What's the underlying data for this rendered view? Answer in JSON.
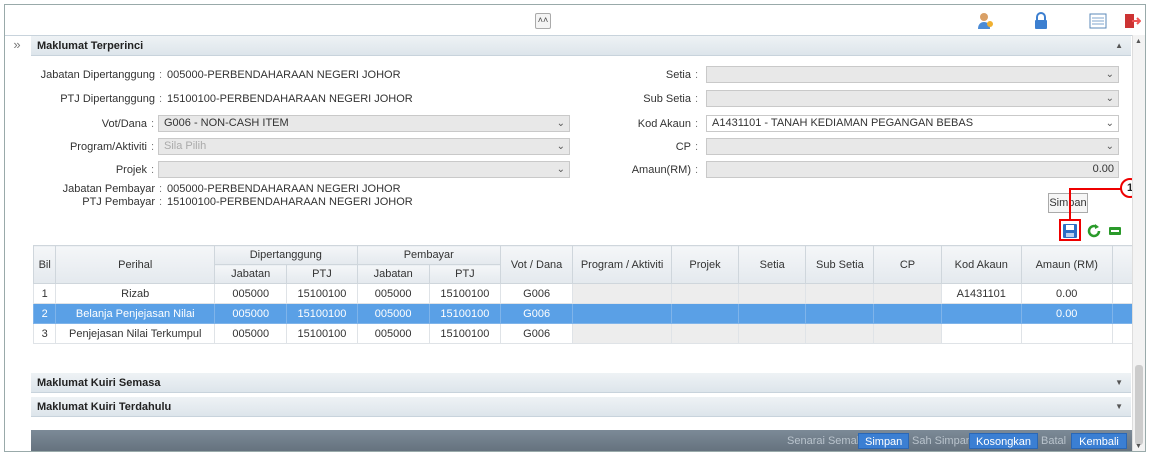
{
  "detail": {
    "title": "Maklumat Terperinci",
    "left_fields": [
      {
        "label": "Jabatan Dipertanggung",
        "value": "005000-PERBENDAHARAAN NEGERI JOHOR"
      },
      {
        "label": "PTJ Dipertanggung",
        "value": "15100100-PERBENDAHARAAN NEGERI JOHOR"
      },
      {
        "label": "Vot/Dana",
        "value": "G006 - NON-CASH ITEM"
      },
      {
        "label": "Program/Aktiviti",
        "value": "Sila Pilih"
      },
      {
        "label": "Projek",
        "value": ""
      }
    ],
    "payer": [
      {
        "label": "Jabatan Pembayar",
        "value": "005000-PERBENDAHARAAN NEGERI JOHOR"
      },
      {
        "label": "PTJ Pembayar",
        "value": "15100100-PERBENDAHARAAN NEGERI JOHOR"
      }
    ],
    "right_fields": [
      {
        "label": "Setia",
        "value": ""
      },
      {
        "label": "Sub Setia",
        "value": ""
      },
      {
        "label": "Kod Akaun",
        "value": "A1431101 - TANAH KEDIAMAN PEGANGAN BEBAS"
      },
      {
        "label": "CP",
        "value": ""
      },
      {
        "label": "Amaun(RM)",
        "value": "0.00"
      }
    ],
    "save_label": "Simpan",
    "callout": "1"
  },
  "table": {
    "headers": {
      "bil": "Bil",
      "perihal": "Perihal",
      "dipertanggung": "Dipertanggung",
      "pembayar": "Pembayar",
      "jabatan": "Jabatan",
      "ptj": "PTJ",
      "vot": "Vot / Dana",
      "program": "Program / Aktiviti",
      "projek": "Projek",
      "setia": "Setia",
      "subsetia": "Sub Setia",
      "cp": "CP",
      "kod": "Kod Akaun",
      "amaun": "Amaun (RM)"
    },
    "rows": [
      {
        "bil": "1",
        "perihal": "Rizab",
        "jab1": "005000",
        "ptj1": "15100100",
        "jab2": "005000",
        "ptj2": "15100100",
        "vot": "G006",
        "kod": "A1431101",
        "amaun": "0.00"
      },
      {
        "bil": "2",
        "perihal": "Belanja Penjejasan Nilai",
        "jab1": "005000",
        "ptj1": "15100100",
        "jab2": "005000",
        "ptj2": "15100100",
        "vot": "G006",
        "kod": "",
        "amaun": "0.00"
      },
      {
        "bil": "3",
        "perihal": "Penjejasan Nilai Terkumpul",
        "jab1": "005000",
        "ptj1": "15100100",
        "jab2": "005000",
        "ptj2": "15100100",
        "vot": "G006",
        "kod": "",
        "amaun": ""
      }
    ]
  },
  "sections": {
    "kuiri_semasa": "Maklumat Kuiri Semasa",
    "kuiri_terdahulu": "Maklumat Kuiri Terdahulu"
  },
  "footer": {
    "senarai_semak": "Senarai Semak",
    "simpan": "Simpan",
    "sah_simpan": "Sah Simpan",
    "kosongkan": "Kosongkan",
    "batal": "Batal",
    "kembali": "Kembali"
  },
  "colors": {
    "selected_row": "#5aa0e6",
    "footer_active": "#3b7fd3",
    "callout": "#e00000"
  }
}
